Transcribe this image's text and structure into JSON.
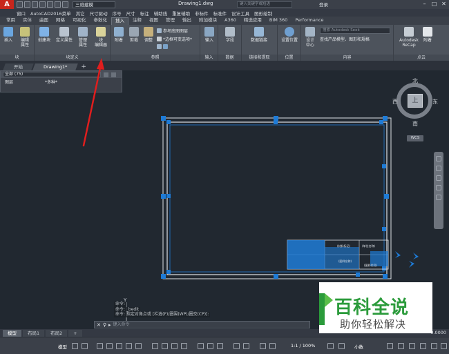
{
  "window": {
    "workspace": "三维建模",
    "doc_title": "Drawing1.dwg",
    "search_placeholder": "键入关键字或短语",
    "login": "登录"
  },
  "menubar": {
    "items": [
      "窗口",
      "AutoCAD2016菜单",
      "其它",
      "尺寸驱动",
      "序号",
      "尺寸",
      "标注",
      "辅助线",
      "重复辅助",
      "非标件",
      "标准件",
      "设计工具",
      "图形绘制"
    ]
  },
  "ribbon_tabs": {
    "items": [
      "常用",
      "实体",
      "曲面",
      "网格",
      "可视化",
      "参数化",
      "插入",
      "注释",
      "视图",
      "管理",
      "输出",
      "附加模块",
      "A360",
      "精选应用",
      "BIM 360",
      "Performance"
    ],
    "active": "插入"
  },
  "ribbon": {
    "block": {
      "label": "块",
      "insert": "插入",
      "edit_attr": "编辑\n属性"
    },
    "block_def": {
      "label": "块定义",
      "create": "创建块",
      "define_attr": "定义属性",
      "manage_attr": "管理\n属性",
      "block_editor": "块\n编辑器"
    },
    "reference": {
      "label": "参照",
      "attach": "附着",
      "clip": "剪裁",
      "adjust": "调整",
      "underlay_layers": "参考底图图层",
      "frame_option": "*边框可变选项*"
    },
    "import": {
      "label": "输入",
      "import": "输入"
    },
    "data": {
      "label": "数据",
      "field": "字段"
    },
    "linking": {
      "label": "链接和提取",
      "data_link": "数据链接"
    },
    "location": {
      "label": "位置",
      "set_location": "设置位置"
    },
    "content": {
      "label": "内容",
      "design_center": "设计\n中心",
      "seek_placeholder": "搜索 Autodesk Seek",
      "seek_desc": "查找产品模型、图形和规格"
    },
    "app": {
      "label": "点云",
      "recap": "Autodesk\nReCap",
      "attach": "附着"
    }
  },
  "doc_tabs": {
    "items": [
      "开始",
      "Drawing1*"
    ],
    "active": "Drawing1*"
  },
  "properties": {
    "selection": "全部 (75)",
    "layer_key": "图层",
    "layer_value": "*多种*"
  },
  "viewcube": {
    "north": "北",
    "south": "南",
    "east": "东",
    "west": "西",
    "face": "上",
    "wcs": "WCS"
  },
  "ucs": {
    "y_label": "Y"
  },
  "title_block": {
    "labels": [
      "(材料标记)",
      "(单位名称)",
      "(图样代号)",
      "(图样名称)"
    ]
  },
  "command": {
    "history": [
      "命令:",
      "命令: _bedit",
      "命令: 指定对角点或 [栏选(F)/圈围(WP)/圈交(CP)]:"
    ],
    "placeholder": "键入命令"
  },
  "layout_tabs": {
    "items": [
      "模型",
      "布局1",
      "布局2"
    ],
    "active": "模型",
    "add": "+"
  },
  "coords": "0.0000",
  "status": {
    "model": "模型",
    "scale": "1:1 / 100%",
    "units": "小数"
  },
  "watermark": {
    "line1": "百科全说",
    "line2": "助你轻松解决"
  },
  "colors": {
    "accent_blue": "#1e7bd6",
    "arrow_red": "#e01e1e",
    "watermark_green": "#2b9b3b",
    "canvas_bg": "#212830"
  }
}
